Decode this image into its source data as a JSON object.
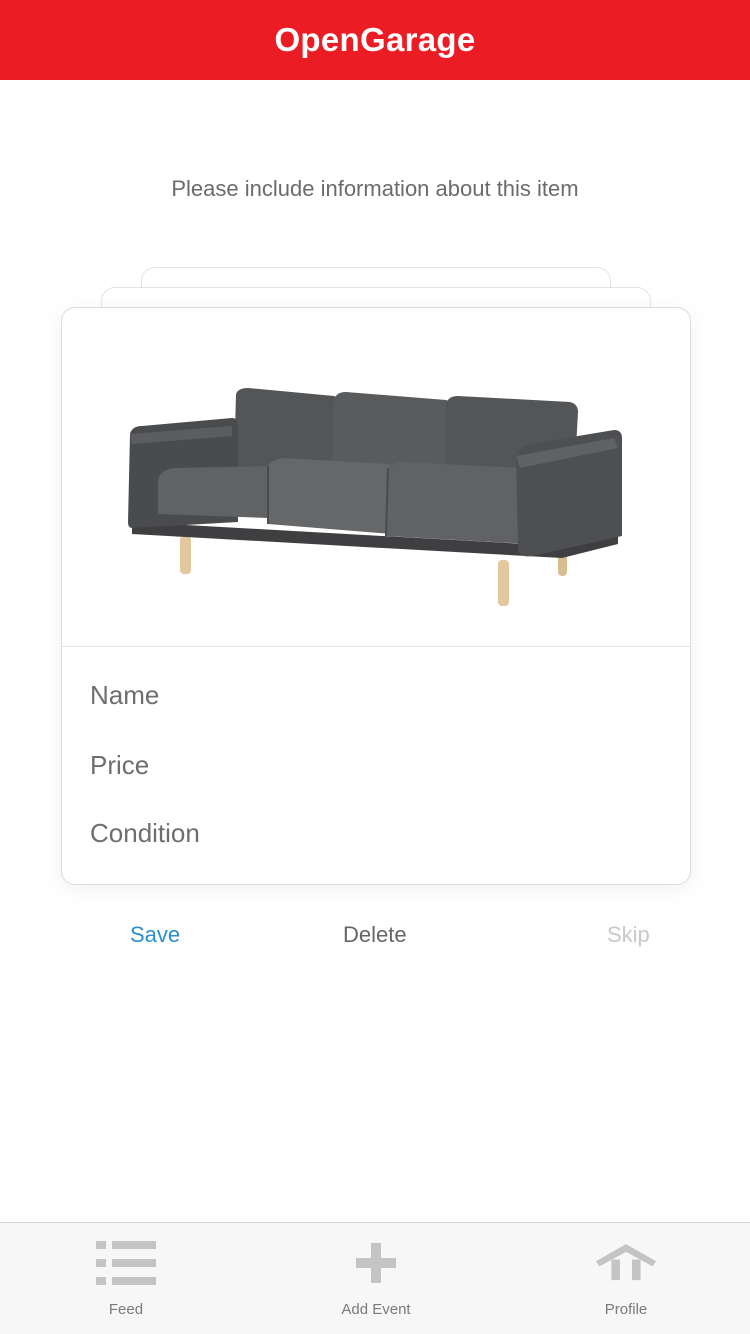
{
  "app": {
    "title": "OpenGarage",
    "brand_color": "#ec1c24"
  },
  "instruction": "Please include information about this item",
  "item_card": {
    "image_alt": "gray three-seat sofa",
    "fields": {
      "name_placeholder": "Name",
      "price_placeholder": "Price",
      "condition_placeholder": "Condition"
    }
  },
  "actions": {
    "save": "Save",
    "delete": "Delete",
    "skip": "Skip",
    "save_color": "#2a8fcf"
  },
  "tab_bar": {
    "tabs": [
      {
        "label": "Feed",
        "icon": "list-icon"
      },
      {
        "label": "Add Event",
        "icon": "plus-icon"
      },
      {
        "label": "Profile",
        "icon": "house-icon"
      }
    ]
  }
}
